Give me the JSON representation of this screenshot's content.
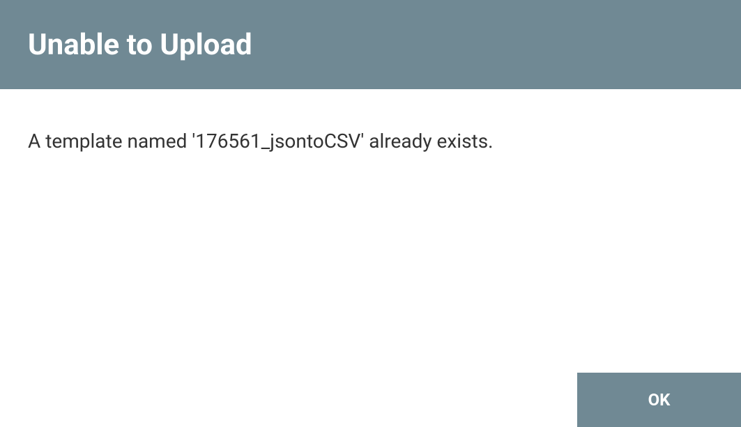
{
  "dialog": {
    "title": "Unable to Upload",
    "message": "A template named '176561_jsontoCSV' already exists.",
    "ok_label": "OK"
  }
}
